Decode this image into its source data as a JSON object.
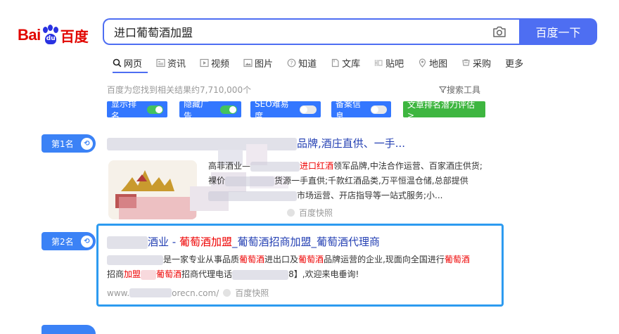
{
  "logo": {
    "bai": "Bai",
    "du": "du",
    "baidu_cn": "百度"
  },
  "search": {
    "query": "进口葡萄酒加盟",
    "button": "百度一下"
  },
  "tabs": [
    {
      "label": "网页",
      "icon": "search-icon"
    },
    {
      "label": "资讯",
      "icon": "news-icon"
    },
    {
      "label": "视频",
      "icon": "video-icon"
    },
    {
      "label": "图片",
      "icon": "image-icon"
    },
    {
      "label": "知道",
      "icon": "question-icon"
    },
    {
      "label": "文库",
      "icon": "doc-icon"
    },
    {
      "label": "贴吧",
      "icon": "tieba-icon"
    },
    {
      "label": "地图",
      "icon": "map-icon"
    },
    {
      "label": "采购",
      "icon": "cart-icon"
    },
    {
      "label": "更多",
      "icon": ""
    }
  ],
  "result_count": "百度为您找到相关结果约7,710,000个",
  "search_tools": "搜索工具",
  "seo_tools": {
    "rank": "显示排名",
    "ads": "隐藏广告",
    "seo": "SEO难易度",
    "record": "备案信息",
    "potential": "文章排名潜力评估 >"
  },
  "results": [
    {
      "rank_label": "第1名",
      "title_tail": "品牌,酒庄直供、一手...",
      "line1_a": "高菲酒业—",
      "line1_b": "进口红酒",
      "line1_c": "领军品牌,中法合作运营、百家酒庄供货;",
      "line2_a": "裸价",
      "line2_b": "货源一手直供;千款红酒品类,万平恒温仓储,总部提供",
      "line3_b": "市场运营、开店指导等一站式服务;小...",
      "kuaizhao": "百度快照"
    },
    {
      "rank_label": "第2名",
      "title_a": "酒业 - ",
      "title_b": "葡萄酒加盟",
      "title_c": "_葡萄酒招商加盟_葡萄酒代理商",
      "line1_a": "是一家专业从事品质",
      "line1_b": "葡萄酒",
      "line1_c": "进出口及",
      "line1_d": "葡萄酒",
      "line1_e": "品牌运营的企业,现面向全国进行",
      "line1_f": "葡萄酒",
      "line2_a": "招商",
      "line2_b": "加盟",
      "line2_c": "葡萄酒",
      "line2_d": "招商代理电话",
      "line2_e": "8】,欢迎来电垂询!",
      "url_a": "www.",
      "url_b": "orecn.com/",
      "kuaizhao": "百度快照"
    }
  ]
}
